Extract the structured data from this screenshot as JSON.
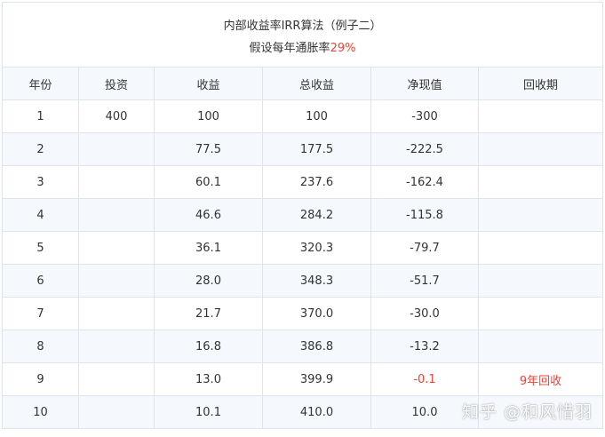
{
  "title": "内部收益率IRR算法（例子二）",
  "subtitle": {
    "prefix": "假设每年通胀率",
    "rate": "29%"
  },
  "columns": [
    "年份",
    "投资",
    "收益",
    "总收益",
    "净现值",
    "回收期"
  ],
  "rows": [
    {
      "year": "1",
      "investment": "400",
      "income": "100",
      "total": "100",
      "npv": "-300",
      "payback": ""
    },
    {
      "year": "2",
      "investment": "",
      "income": "77.5",
      "total": "177.5",
      "npv": "-222.5",
      "payback": ""
    },
    {
      "year": "3",
      "investment": "",
      "income": "60.1",
      "total": "237.6",
      "npv": "-162.4",
      "payback": ""
    },
    {
      "year": "4",
      "investment": "",
      "income": "46.6",
      "total": "284.2",
      "npv": "-115.8",
      "payback": ""
    },
    {
      "year": "5",
      "investment": "",
      "income": "36.1",
      "total": "320.3",
      "npv": "-79.7",
      "payback": ""
    },
    {
      "year": "6",
      "investment": "",
      "income": "28.0",
      "total": "348.3",
      "npv": "-51.7",
      "payback": ""
    },
    {
      "year": "7",
      "investment": "",
      "income": "21.7",
      "total": "370.0",
      "npv": "-30.0",
      "payback": ""
    },
    {
      "year": "8",
      "investment": "",
      "income": "16.8",
      "total": "386.8",
      "npv": "-13.2",
      "payback": ""
    },
    {
      "year": "9",
      "investment": "",
      "income": "13.0",
      "total": "399.9",
      "npv": "-0.1",
      "payback": "9年回收"
    },
    {
      "year": "10",
      "investment": "",
      "income": "10.1",
      "total": "410.0",
      "npv": "10.0",
      "payback": ""
    }
  ],
  "watermark": "知乎 @和风惜羽",
  "colors": {
    "highlight": "#e4463c",
    "stripe": "#f5f8fc",
    "border": "#dfe3ea"
  }
}
